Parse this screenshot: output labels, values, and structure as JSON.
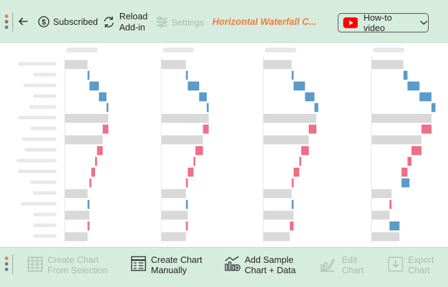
{
  "toolbar": {
    "subscribed_label": "Subscribed",
    "reload_label_1": "Reload",
    "reload_label_2": "Add-in",
    "settings_label": "Settings",
    "title": "Horizontal Waterfall C...",
    "howto_label": "How-to video"
  },
  "bottombar": {
    "create_selection_1": "Create Chart",
    "create_selection_2": "From Selection",
    "create_manual_1": "Create Chart",
    "create_manual_2": "Manually",
    "add_sample_1": "Add Sample",
    "add_sample_2": "Chart + Data",
    "edit_1": "Edit",
    "edit_2": "Chart",
    "export_1": "Export",
    "export_2": "Chart"
  },
  "colors": {
    "total": "#d9d9d9",
    "increase": "#5b9bc8",
    "decrease": "#ef6f86",
    "placeholder": "#e8e8e8",
    "bar_background": "#d6ecdf",
    "accent": "#f07c3c"
  },
  "chart_data": [
    {
      "type": "bar",
      "orientation": "horizontal-waterfall",
      "values": [
        {
          "kind": "total",
          "v": 12
        },
        {
          "kind": "increase",
          "v": 1
        },
        {
          "kind": "increase",
          "v": 5
        },
        {
          "kind": "increase",
          "v": 4
        },
        {
          "kind": "increase",
          "v": 1
        },
        {
          "kind": "total",
          "v": 23
        },
        {
          "kind": "decrease",
          "v": 3
        },
        {
          "kind": "total",
          "v": 20
        },
        {
          "kind": "decrease",
          "v": 3
        },
        {
          "kind": "decrease",
          "v": 1
        },
        {
          "kind": "decrease",
          "v": 2
        },
        {
          "kind": "decrease",
          "v": 1
        },
        {
          "kind": "total",
          "v": 12
        },
        {
          "kind": "increase",
          "v": 1
        },
        {
          "kind": "total",
          "v": 13
        },
        {
          "kind": "decrease",
          "v": 1
        },
        {
          "kind": "total",
          "v": 12
        }
      ]
    },
    {
      "type": "bar",
      "orientation": "horizontal-waterfall",
      "values": [
        {
          "kind": "total",
          "v": 13
        },
        {
          "kind": "increase",
          "v": 1
        },
        {
          "kind": "increase",
          "v": 6
        },
        {
          "kind": "increase",
          "v": 4
        },
        {
          "kind": "increase",
          "v": 1
        },
        {
          "kind": "total",
          "v": 25
        },
        {
          "kind": "decrease",
          "v": 3
        },
        {
          "kind": "total",
          "v": 22
        },
        {
          "kind": "decrease",
          "v": 4
        },
        {
          "kind": "decrease",
          "v": 1
        },
        {
          "kind": "decrease",
          "v": 3
        },
        {
          "kind": "decrease",
          "v": 1
        },
        {
          "kind": "total",
          "v": 13
        },
        {
          "kind": "increase",
          "v": 1
        },
        {
          "kind": "total",
          "v": 14
        },
        {
          "kind": "decrease",
          "v": 1
        },
        {
          "kind": "total",
          "v": 13
        }
      ]
    },
    {
      "type": "bar",
      "orientation": "horizontal-waterfall",
      "values": [
        {
          "kind": "total",
          "v": 15
        },
        {
          "kind": "increase",
          "v": 1
        },
        {
          "kind": "increase",
          "v": 6
        },
        {
          "kind": "increase",
          "v": 5
        },
        {
          "kind": "increase",
          "v": 2
        },
        {
          "kind": "total",
          "v": 28
        },
        {
          "kind": "decrease",
          "v": 4
        },
        {
          "kind": "total",
          "v": 24
        },
        {
          "kind": "decrease",
          "v": 4
        },
        {
          "kind": "decrease",
          "v": 1
        },
        {
          "kind": "decrease",
          "v": 3
        },
        {
          "kind": "decrease",
          "v": 1
        },
        {
          "kind": "total",
          "v": 15
        },
        {
          "kind": "increase",
          "v": 1
        },
        {
          "kind": "total",
          "v": 16
        },
        {
          "kind": "decrease",
          "v": 2
        },
        {
          "kind": "total",
          "v": 14
        }
      ]
    },
    {
      "type": "bar",
      "orientation": "horizontal-waterfall",
      "values": [
        {
          "kind": "total",
          "v": 16
        },
        {
          "kind": "increase",
          "v": 2
        },
        {
          "kind": "increase",
          "v": 6
        },
        {
          "kind": "increase",
          "v": 6
        },
        {
          "kind": "increase",
          "v": 2
        },
        {
          "kind": "total",
          "v": 30
        },
        {
          "kind": "decrease",
          "v": 5
        },
        {
          "kind": "total",
          "v": 25
        },
        {
          "kind": "decrease",
          "v": 5
        },
        {
          "kind": "decrease",
          "v": 2
        },
        {
          "kind": "decrease",
          "v": 3
        },
        {
          "kind": "increase",
          "v": 4
        },
        {
          "kind": "total",
          "v": 10
        },
        {
          "kind": "decrease",
          "v": 1
        },
        {
          "kind": "total",
          "v": 9
        },
        {
          "kind": "increase",
          "v": 5
        },
        {
          "kind": "total",
          "v": 14
        }
      ]
    }
  ]
}
